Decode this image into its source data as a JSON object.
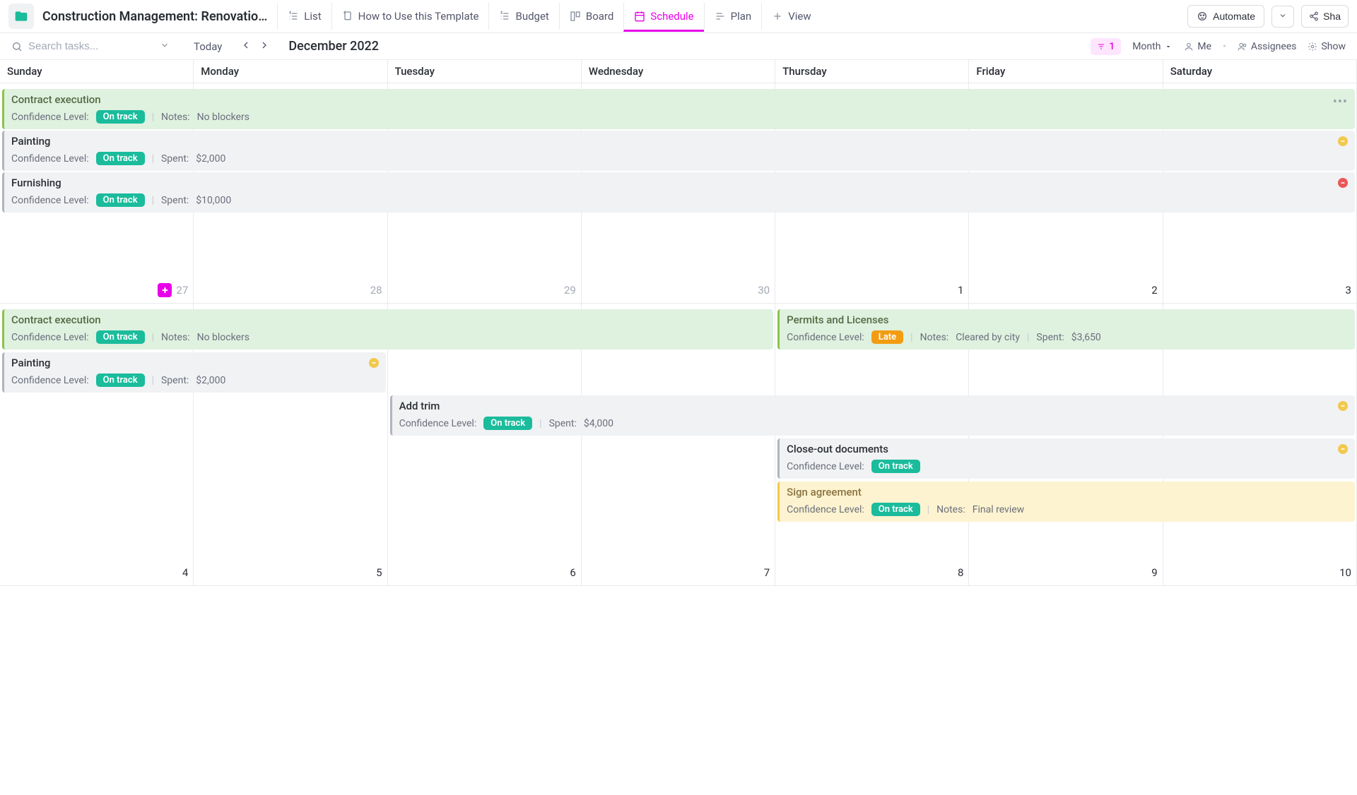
{
  "header": {
    "title": "Construction Management: Renovatio…",
    "tabs": [
      {
        "label": "List"
      },
      {
        "label": "How to Use this Template"
      },
      {
        "label": "Budget"
      },
      {
        "label": "Board"
      },
      {
        "label": "Schedule",
        "active": true
      },
      {
        "label": "Plan"
      },
      {
        "label": "View",
        "add": true
      }
    ],
    "automate": "Automate",
    "share": "Sha"
  },
  "subbar": {
    "search_placeholder": "Search tasks...",
    "today": "Today",
    "month_title": "December 2022",
    "filter_count": "1",
    "view_mode": "Month",
    "me": "Me",
    "assignees": "Assignees",
    "show": "Show"
  },
  "calendar": {
    "days": [
      "Sunday",
      "Monday",
      "Tuesday",
      "Wednesday",
      "Thursday",
      "Friday",
      "Saturday"
    ],
    "row1_dates": [
      "27",
      "28",
      "29",
      "30",
      "1",
      "2",
      "3"
    ],
    "row2_dates": [
      "4",
      "5",
      "6",
      "7",
      "8",
      "9",
      "10"
    ],
    "events": {
      "contract1": {
        "title": "Contract execution",
        "conf_label": "Confidence Level:",
        "badge": "On track",
        "notes_label": "Notes:",
        "notes": "No blockers"
      },
      "painting1": {
        "title": "Painting",
        "conf_label": "Confidence Level:",
        "badge": "On track",
        "spent_label": "Spent:",
        "spent": "$2,000"
      },
      "furnishing": {
        "title": "Furnishing",
        "conf_label": "Confidence Level:",
        "badge": "On track",
        "spent_label": "Spent:",
        "spent": "$10,000"
      },
      "contract2": {
        "title": "Contract execution",
        "conf_label": "Confidence Level:",
        "badge": "On track",
        "notes_label": "Notes:",
        "notes": "No blockers"
      },
      "permits": {
        "title": "Permits and Licenses",
        "conf_label": "Confidence Level:",
        "badge": "Late",
        "notes_label": "Notes:",
        "notes": "Cleared by city",
        "spent_label": "Spent:",
        "spent": "$3,650"
      },
      "painting2": {
        "title": "Painting",
        "conf_label": "Confidence Level:",
        "badge": "On track",
        "spent_label": "Spent:",
        "spent": "$2,000"
      },
      "addtrim": {
        "title": "Add trim",
        "conf_label": "Confidence Level:",
        "badge": "On track",
        "spent_label": "Spent:",
        "spent": "$4,000"
      },
      "closeout": {
        "title": "Close-out documents",
        "conf_label": "Confidence Level:",
        "badge": "On track"
      },
      "sign": {
        "title": "Sign agreement",
        "conf_label": "Confidence Level:",
        "badge": "On track",
        "notes_label": "Notes:",
        "notes": "Final review"
      }
    }
  }
}
